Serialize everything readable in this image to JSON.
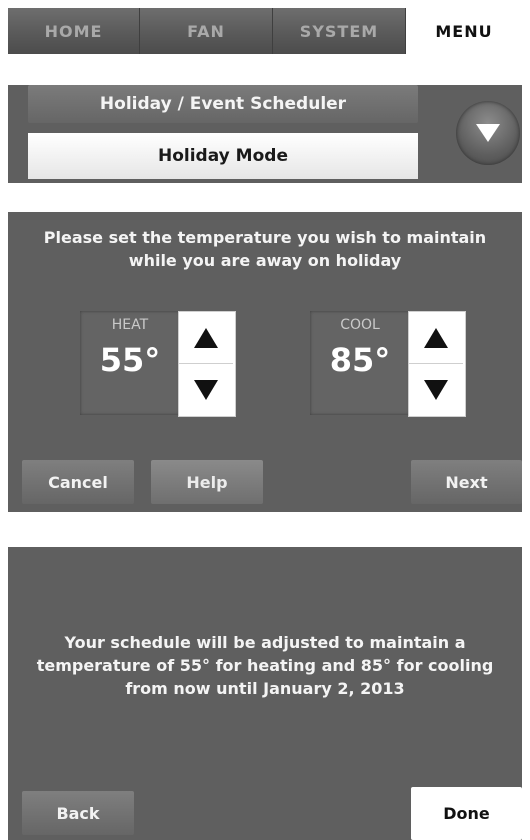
{
  "tabs": [
    {
      "label": "HOME"
    },
    {
      "label": "FAN"
    },
    {
      "label": "SYSTEM"
    },
    {
      "label": "MENU"
    }
  ],
  "active_tab": "MENU",
  "header": {
    "title": "Holiday / Event Scheduler",
    "mode": "Holiday Mode",
    "scroll_icon": "chevron-down-icon"
  },
  "temperature": {
    "message": "Please set the temperature you wish to maintain while you are away on holiday",
    "heat": {
      "label": "HEAT",
      "value": "55°"
    },
    "cool": {
      "label": "COOL",
      "value": "85°"
    },
    "buttons": {
      "cancel": "Cancel",
      "help": "Help",
      "next": "Next"
    }
  },
  "confirmation": {
    "message": "Your schedule will be adjusted to maintain a temperature of 55° for heating and 85° for cooling from now until January 2, 2013",
    "buttons": {
      "back": "Back",
      "done": "Done"
    }
  },
  "colors": {
    "panel": "#5f5f5f",
    "active_tab": "#ffffff"
  }
}
